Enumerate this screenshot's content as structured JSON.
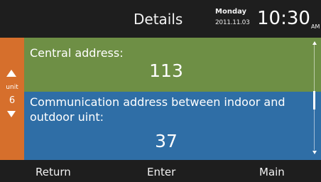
{
  "header": {
    "title": "Details",
    "day": "Monday",
    "date": "2011.11.03",
    "time": "10:30",
    "ampm": "AM"
  },
  "unit_panel": {
    "label": "unit",
    "number": "6",
    "up_icon": "triangle-up",
    "down_icon": "triangle-down",
    "color": "#d66f2c"
  },
  "rows": [
    {
      "label": "Central address:",
      "value": "113",
      "color": "#6e8f45"
    },
    {
      "label": "Communication address between indoor and outdoor uint:",
      "value": "37",
      "color": "#2f6ea6"
    }
  ],
  "footer": {
    "return_label": "Return",
    "enter_label": "Enter",
    "main_label": "Main"
  }
}
